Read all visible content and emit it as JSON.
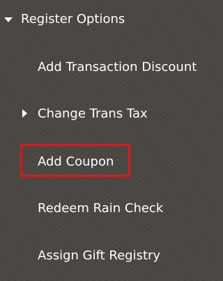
{
  "menu": {
    "header": {
      "label": "Register Options",
      "icon": "caret-down-icon"
    },
    "items": [
      {
        "label": "Add Transaction Discount"
      },
      {
        "label": "Change Trans Tax",
        "icon": "caret-right-icon"
      },
      {
        "label": "Add Coupon",
        "highlighted": true
      },
      {
        "label": "Redeem Rain Check"
      },
      {
        "label": "Assign Gift Registry"
      }
    ]
  },
  "colors": {
    "background": "#4a4742",
    "text": "#ffffff",
    "highlight_border": "#e3151f"
  }
}
